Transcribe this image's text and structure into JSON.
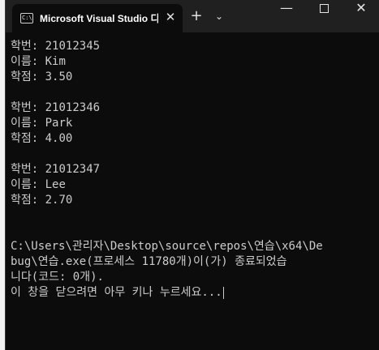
{
  "window": {
    "tab_title": "Microsoft Visual Studio 디버그 콘솔",
    "tab_icon_text": "C:\\",
    "close_tab_label": "✕",
    "new_tab_label": "+",
    "dropdown_label": "⌄",
    "minimize_label": "—",
    "close_label": "✕"
  },
  "console": {
    "records": [
      {
        "id_line": "학번: 21012345",
        "name_line": "이름: Kim",
        "gpa_line": "학점: 3.50"
      },
      {
        "id_line": "학번: 21012346",
        "name_line": "이름: Park",
        "gpa_line": "학점: 4.00"
      },
      {
        "id_line": "학번: 21012347",
        "name_line": "이름: Lee",
        "gpa_line": "학점: 2.70"
      }
    ],
    "exit_lines": [
      "C:\\Users\\관리자\\Desktop\\source\\repos\\연습\\x64\\De",
      "bug\\연습.exe(프로세스 11780개)이(가) 종료되었습",
      "니다(코드: 0개).",
      "이 창을 닫으려면 아무 키나 누르세요..."
    ]
  }
}
